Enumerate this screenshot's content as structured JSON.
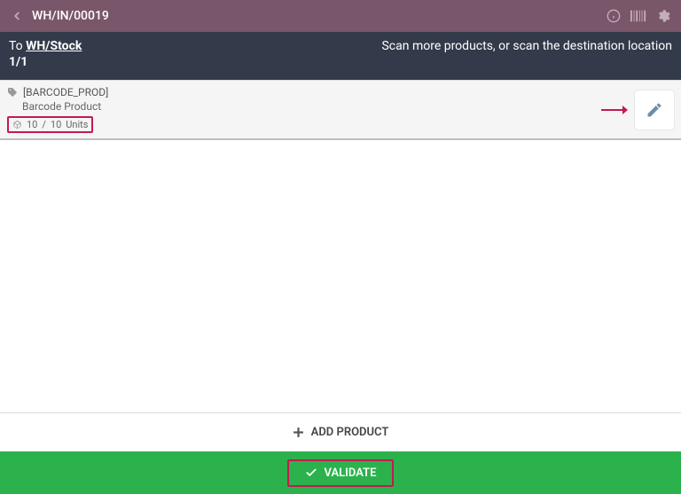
{
  "topbar": {
    "title": "WH/IN/00019"
  },
  "subbar": {
    "to_label": "To",
    "location": "WH/Stock",
    "counter": "1/1",
    "hint": "Scan more products, or scan the destination location"
  },
  "product": {
    "code": "[BARCODE_PROD]",
    "name": "Barcode Product",
    "qty_done": "10",
    "qty_sep": "/",
    "qty_total": "10",
    "uom": "Units"
  },
  "buttons": {
    "add_product": "ADD PRODUCT",
    "validate": "VALIDATE"
  }
}
